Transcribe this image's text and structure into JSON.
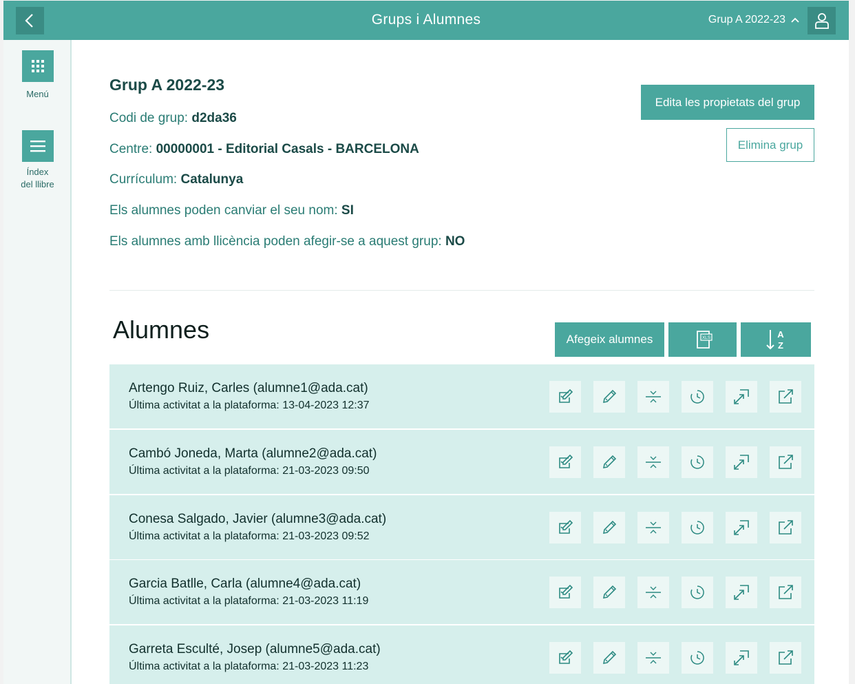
{
  "header": {
    "title": "Grups i Alumnes",
    "group_selector": "Grup A 2022-23"
  },
  "sidebar": {
    "items": [
      {
        "label": "Menú",
        "icon": "grid-icon"
      },
      {
        "label_line1": "Índex",
        "label_line2": "del llibre",
        "icon": "list-icon"
      }
    ]
  },
  "group": {
    "title": "Grup A 2022-23",
    "code_label": "Codi de grup: ",
    "code_value": "d2da36",
    "center_label": "Centre: ",
    "center_value": "00000001 - Editorial Casals - BARCELONA",
    "curriculum_label": "Currículum: ",
    "curriculum_value": "Catalunya",
    "rename_label": "Els alumnes poden canviar el seu nom: ",
    "rename_value": "SI",
    "join_label": "Els alumnes amb llicència poden afegir-se a aquest grup: ",
    "join_value": "NO",
    "edit_button": "Edita les propietats del grup",
    "delete_button": "Elimina grup"
  },
  "students_section": {
    "title": "Alumnes",
    "add_button": "Afegeix alumnes",
    "xls_button_icon": "xls-export-icon",
    "sort_button_icon": "sort-az-icon"
  },
  "students": [
    {
      "name": "Artengo Ruiz, Carles (alumne1@ada.cat)",
      "activity": "Última activitat a la plataforma: 13-04-2023 12:37"
    },
    {
      "name": "Cambó Joneda, Marta (alumne2@ada.cat)",
      "activity": "Última activitat a la plataforma: 21-03-2023 09:50"
    },
    {
      "name": "Conesa Salgado, Javier (alumne3@ada.cat)",
      "activity": "Última activitat a la plataforma: 21-03-2023 09:52"
    },
    {
      "name": "Garcia Batlle, Carla (alumne4@ada.cat)",
      "activity": "Última activitat a la plataforma: 21-03-2023 11:19"
    },
    {
      "name": "Garreta Esculté, Josep (alumne5@ada.cat)",
      "activity": "Última activitat a la plataforma: 21-03-2023 11:23"
    }
  ],
  "colors": {
    "accent": "#4aa79e",
    "accent_dark": "#3a8c84",
    "row_bg": "#d6efec",
    "text_dark": "#1b4a47"
  }
}
